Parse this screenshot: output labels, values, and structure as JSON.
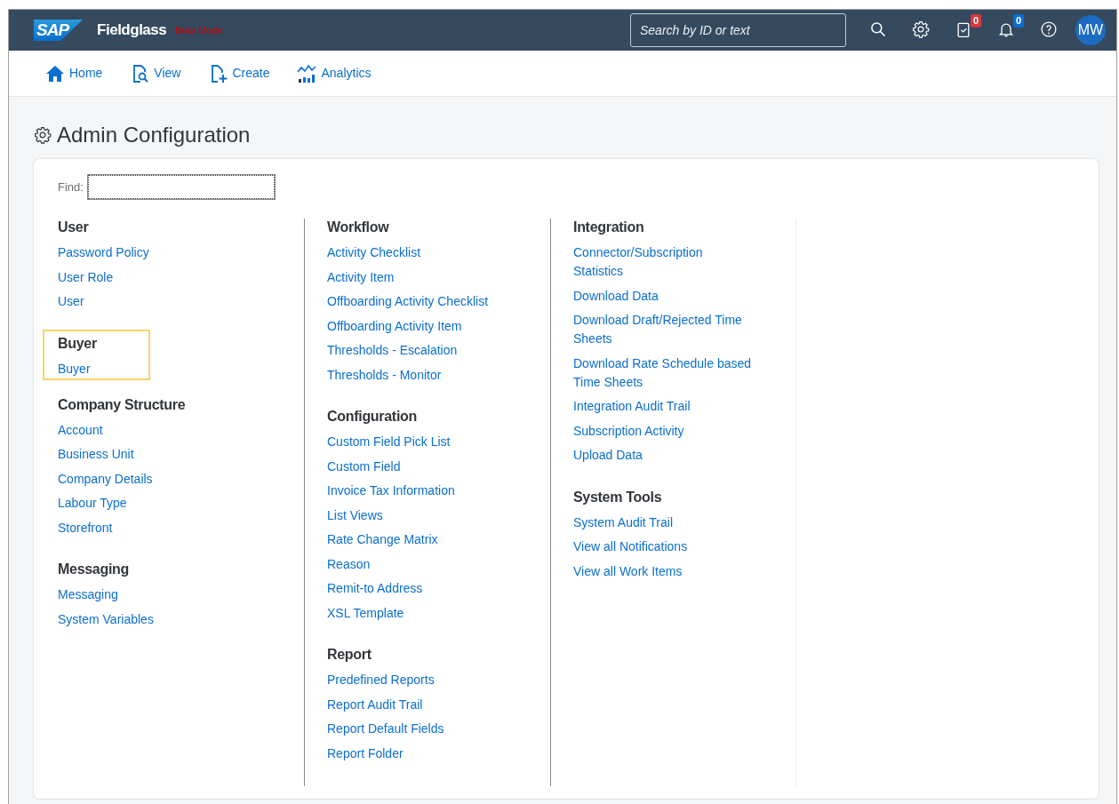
{
  "header": {
    "logo": "SAP",
    "product": "Fieldglass",
    "mode": "Beta Mode",
    "search": {
      "placeholder": "Search by ID or text"
    },
    "tasks_count": "0",
    "notifications_count": "0",
    "avatar": "MW"
  },
  "nav": [
    {
      "label": "Home",
      "kind": "home"
    },
    {
      "label": "View",
      "kind": "view"
    },
    {
      "label": "Create",
      "kind": "create"
    },
    {
      "label": "Analytics",
      "kind": "analytics"
    }
  ],
  "page_title": "Admin Configuration",
  "find": {
    "label": "Find:"
  },
  "columns": [
    {
      "sections": [
        {
          "heading": "User",
          "highlighted": false,
          "links": [
            "Password Policy",
            "User Role",
            "User"
          ]
        },
        {
          "heading": "Buyer",
          "highlighted": true,
          "links": [
            "Buyer"
          ]
        },
        {
          "heading": "Company Structure",
          "highlighted": false,
          "links": [
            "Account",
            "Business Unit",
            "Company Details",
            "Labour Type",
            "Storefront"
          ]
        },
        {
          "heading": "Messaging",
          "highlighted": false,
          "links": [
            "Messaging",
            "System Variables"
          ]
        }
      ]
    },
    {
      "sections": [
        {
          "heading": "Workflow",
          "highlighted": false,
          "links": [
            "Activity Checklist",
            "Activity Item",
            "Offboarding Activity Checklist",
            "Offboarding Activity Item",
            "Thresholds - Escalation",
            "Thresholds - Monitor"
          ]
        },
        {
          "heading": "Configuration",
          "highlighted": false,
          "links": [
            "Custom Field Pick List",
            "Custom Field",
            "Invoice Tax Information",
            "List Views",
            "Rate Change Matrix",
            "Reason",
            "Remit-to Address",
            "XSL Template"
          ]
        },
        {
          "heading": "Report",
          "highlighted": false,
          "links": [
            "Predefined Reports",
            "Report Audit Trail",
            "Report Default Fields",
            "Report Folder"
          ]
        }
      ]
    },
    {
      "sections": [
        {
          "heading": "Integration",
          "highlighted": false,
          "links": [
            "Connector/Subscription Statistics",
            "Download Data",
            "Download Draft/Rejected Time Sheets",
            "Download Rate Schedule based Time Sheets",
            "Integration Audit Trail",
            "Subscription Activity",
            "Upload Data"
          ]
        },
        {
          "heading": "System Tools",
          "highlighted": false,
          "links": [
            "System Audit Trail",
            "View all Notifications",
            "View all Work Items"
          ]
        }
      ]
    }
  ]
}
